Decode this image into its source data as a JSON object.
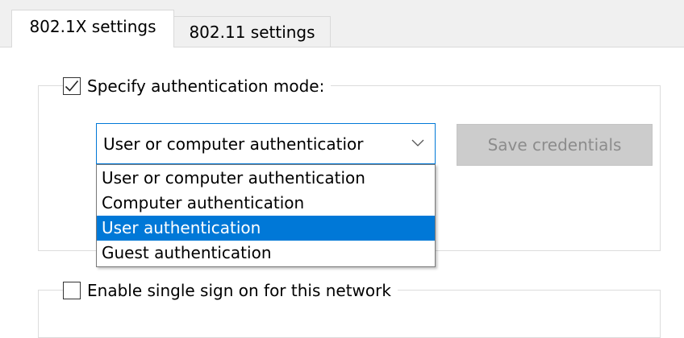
{
  "tabs": [
    {
      "label": "802.1X settings",
      "active": true
    },
    {
      "label": "802.11 settings",
      "active": false
    }
  ],
  "auth_group": {
    "label": "Specify authentication mode:",
    "checked": true,
    "combo": {
      "value": "User or computer authenticatior",
      "options": [
        "User or computer authentication",
        "Computer authentication",
        "User authentication",
        "Guest authentication"
      ],
      "highlighted_option": "User authentication"
    },
    "save_button_label": "Save credentials"
  },
  "sso_group": {
    "label": "Enable single sign on for this network",
    "checked": false
  },
  "colors": {
    "accent": "#0078d7",
    "selection_text": "#ffffff",
    "disabled_button_bg": "#cccccc",
    "disabled_button_text": "#8c8c8c",
    "tab_strip_bg": "#f0f0f0"
  },
  "icons": {
    "checkbox_checked": "checkmark-icon",
    "combo_arrow": "chevron-down-icon"
  }
}
